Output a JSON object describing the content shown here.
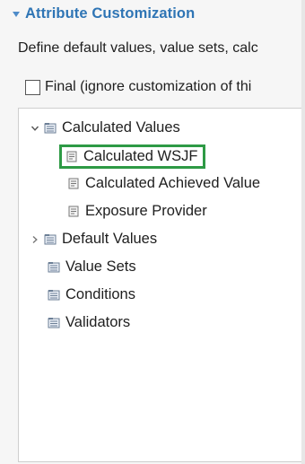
{
  "section": {
    "title": "Attribute Customization",
    "description": "Define default values, value sets, calc"
  },
  "final_checkbox": {
    "label": "Final (ignore customization of thi",
    "checked": false
  },
  "tree": {
    "items": [
      {
        "label": "Calculated Values",
        "level": 0,
        "expanded": true,
        "icon": "folder-icon"
      },
      {
        "label": "Calculated WSJF",
        "level": 1,
        "selected": true,
        "icon": "script-icon"
      },
      {
        "label": "Calculated Achieved Value",
        "level": 1,
        "icon": "script-icon"
      },
      {
        "label": "Exposure Provider",
        "level": 1,
        "icon": "script-icon"
      },
      {
        "label": "Default Values",
        "level": 0,
        "expanded": false,
        "icon": "folder-icon"
      },
      {
        "label": "Value Sets",
        "level": 0,
        "icon": "folder-icon"
      },
      {
        "label": "Conditions",
        "level": 0,
        "icon": "folder-icon"
      },
      {
        "label": "Validators",
        "level": 0,
        "icon": "folder-icon"
      }
    ]
  },
  "colors": {
    "section_title": "#2f75b5",
    "selection_border": "#2e9a45"
  }
}
